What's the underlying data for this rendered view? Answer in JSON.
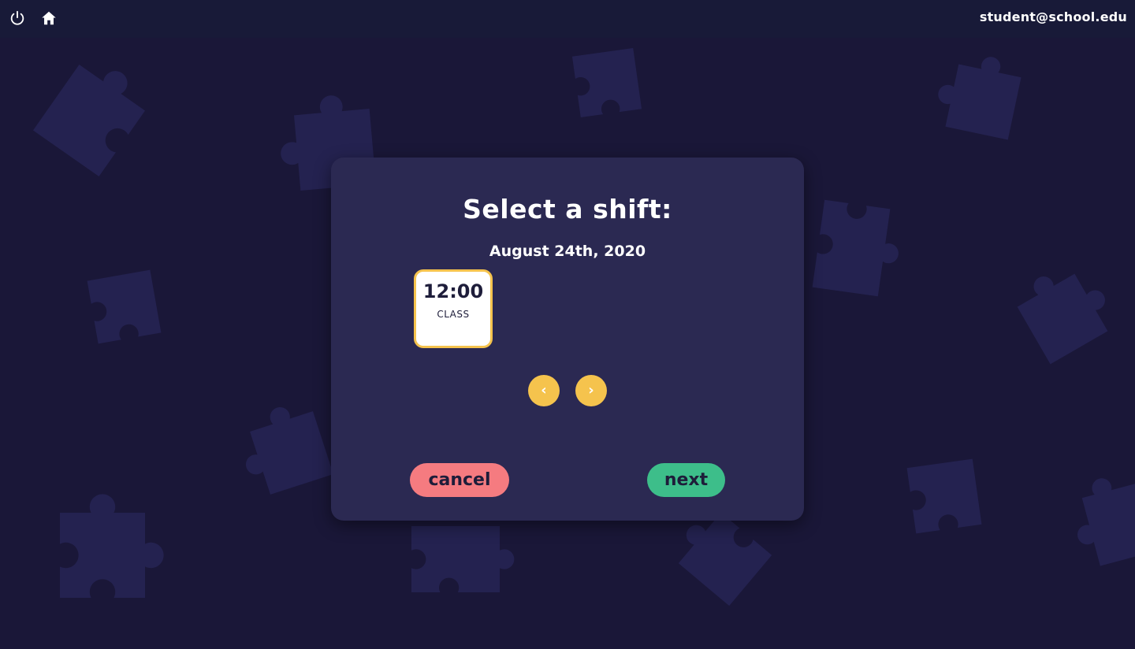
{
  "topbar": {
    "user_email": "student@school.edu",
    "icons": [
      "power-icon",
      "home-icon"
    ]
  },
  "modal": {
    "title": "Select a shift:",
    "date": "August 24th, 2020",
    "shifts": [
      {
        "time": "12:00",
        "type": "CLASS",
        "selected": true
      }
    ],
    "prev_label": "‹",
    "next_page_label": "›",
    "cancel_label": "cancel",
    "next_label": "next"
  },
  "colors": {
    "background": "#1a1738",
    "topbar": "#181a38",
    "modal": "#2b2952",
    "accent_yellow": "#f5c34d",
    "cancel_red": "#f57b80",
    "next_green": "#3dbe8a",
    "puzzle": "#242250"
  }
}
